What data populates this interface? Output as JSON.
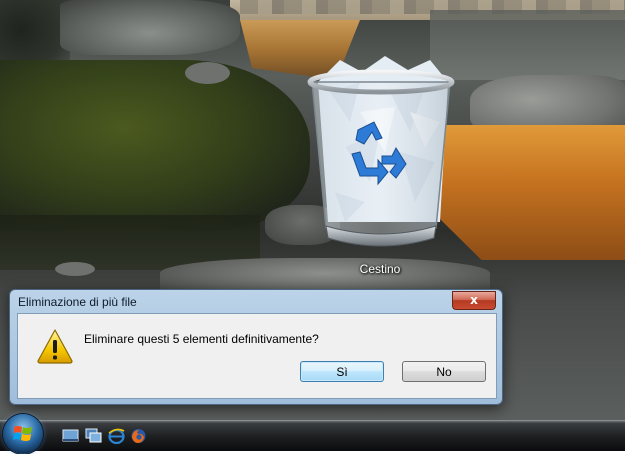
{
  "desktop": {
    "icons": [
      {
        "label": "Cestino",
        "icon": "recycle-bin-full-icon"
      }
    ]
  },
  "dialog": {
    "title": "Eliminazione di più file",
    "close_label": "x",
    "icon": "warning-icon",
    "message": "Eliminare questi 5 elementi definitivamente?",
    "buttons": {
      "yes": "Sì",
      "no": "No"
    }
  },
  "taskbar": {
    "start_icon": "windows-start-orb-icon",
    "quick_launch": [
      "show-desktop-icon",
      "switch-windows-icon",
      "internet-explorer-icon",
      "firefox-icon"
    ]
  }
}
